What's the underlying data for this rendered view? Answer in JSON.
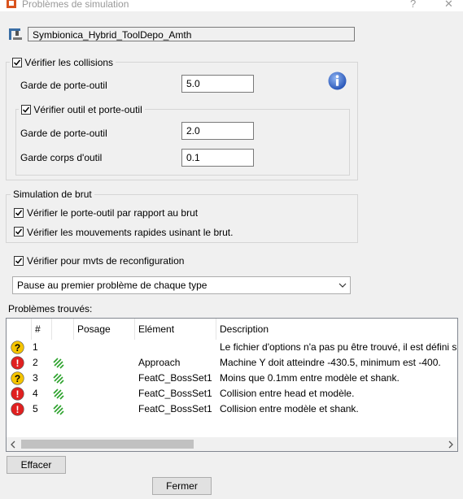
{
  "window": {
    "title": "Problèmes de simulation",
    "help_glyph": "?",
    "close_glyph": "✕"
  },
  "machine": {
    "value": "Symbionica_Hybrid_ToolDepo_Amth",
    "icon": "machine-tool-icon"
  },
  "collisions": {
    "checkbox_label": "Vérifier les collisions",
    "checked": true,
    "holder_gap_label": "Garde de porte-outil",
    "holder_gap_value": "5.0",
    "info_icon": "info-icon",
    "tool_group": {
      "checkbox_label": "Vérifier outil et porte-outil",
      "checked": true,
      "holder_gap_label": "Garde de porte-outil",
      "holder_gap_value": "2.0",
      "body_gap_label": "Garde corps d'outil",
      "body_gap_value": "0.1"
    }
  },
  "stock": {
    "group_title": "Simulation de brut",
    "check_holder_label": "Vérifier le porte-outil par rapport au brut",
    "check_holder_checked": true,
    "check_rapid_label": "Vérifier les mouvements rapides usinant le brut.",
    "check_rapid_checked": true
  },
  "reconfig": {
    "label": "Vérifier pour mvts de reconfiguration",
    "checked": true
  },
  "pause_select": {
    "value": "Pause au premier problème de chaque type"
  },
  "problems": {
    "title": "Problèmes trouvés:",
    "columns": [
      "#",
      "",
      "Posage",
      "Elément",
      "Description"
    ],
    "rows": [
      {
        "severity": "warning",
        "num": "1",
        "has_op": false,
        "posage": "",
        "element": "",
        "description": "Le fichier d'options n'a pas pu être trouvé, il est défini sur"
      },
      {
        "severity": "error",
        "num": "2",
        "has_op": true,
        "posage": "",
        "element": "Approach",
        "description": "Machine Y doit atteindre -430.5, minimum est -400."
      },
      {
        "severity": "warning",
        "num": "3",
        "has_op": true,
        "posage": "",
        "element": "FeatC_BossSet1",
        "description": "Moins que 0.1mm entre modèle et shank."
      },
      {
        "severity": "error",
        "num": "4",
        "has_op": true,
        "posage": "",
        "element": "FeatC_BossSet1",
        "description": "Collision entre head et modèle."
      },
      {
        "severity": "error",
        "num": "5",
        "has_op": true,
        "posage": "",
        "element": "FeatC_BossSet1",
        "description": "Collision entre modèle et shank."
      }
    ],
    "colors": {
      "warning": "#f5c400",
      "error": "#e02020",
      "operation": "#2aa12a"
    }
  },
  "buttons": {
    "clear": "Effacer",
    "close": "Fermer"
  }
}
